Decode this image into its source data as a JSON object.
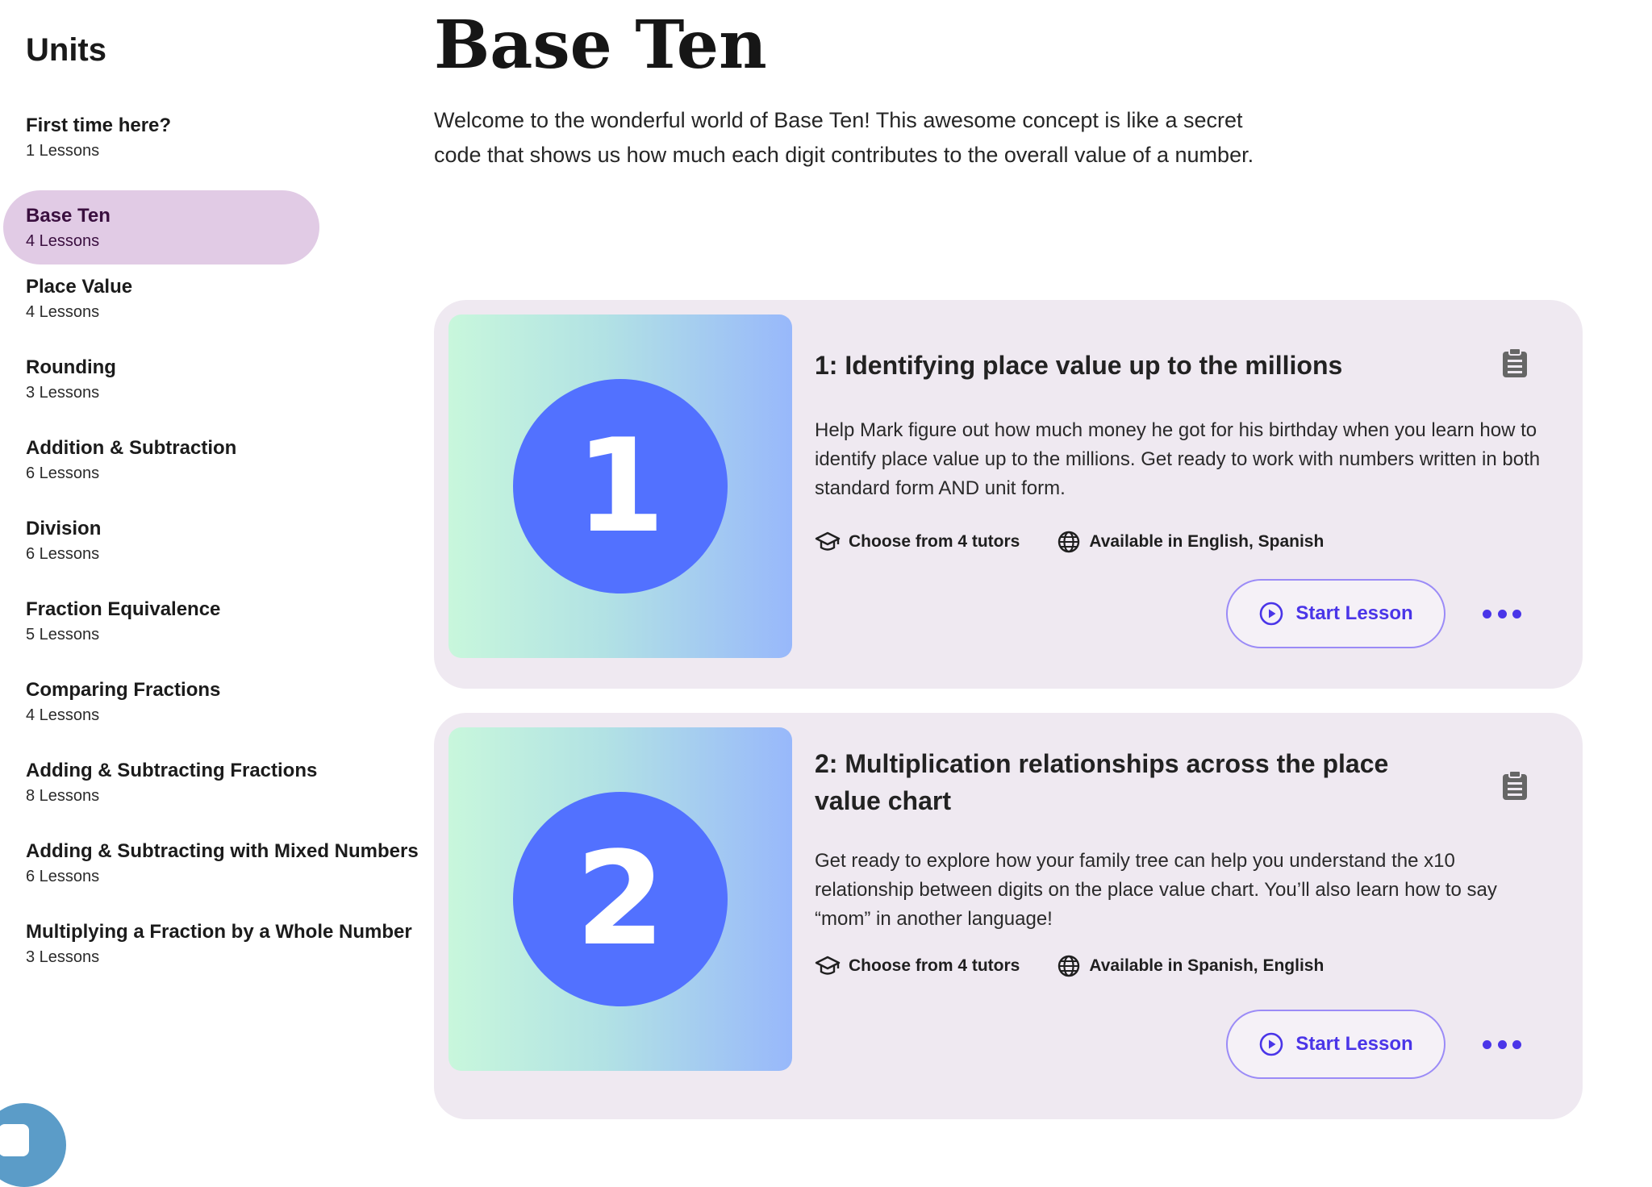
{
  "sidebar": {
    "title": "Units",
    "units": [
      {
        "name": "First time here?",
        "lessons": "1 Lessons"
      },
      {
        "name": "Base Ten",
        "lessons": "4 Lessons",
        "active": true
      },
      {
        "name": "Place Value",
        "lessons": "4 Lessons"
      },
      {
        "name": "Rounding",
        "lessons": "3 Lessons"
      },
      {
        "name": "Addition & Subtraction",
        "lessons": "6 Lessons"
      },
      {
        "name": "Division",
        "lessons": "6 Lessons"
      },
      {
        "name": "Fraction Equivalence",
        "lessons": "5 Lessons"
      },
      {
        "name": "Comparing Fractions",
        "lessons": "4 Lessons"
      },
      {
        "name": "Adding & Subtracting Fractions",
        "lessons": "8 Lessons"
      },
      {
        "name": "Adding & Subtracting with Mixed Numbers",
        "lessons": "6 Lessons"
      },
      {
        "name": "Multiplying a Fraction by a Whole Number",
        "lessons": "3 Lessons"
      }
    ]
  },
  "main": {
    "title": "Base Ten",
    "intro": "Welcome to the wonderful world of Base Ten! This awesome concept is like a secret code that shows us how much each digit contributes to the overall value of a number.",
    "lessons": [
      {
        "number": "1",
        "title": "1: Identifying place value up to the millions",
        "description": "Help Mark figure out how much money he got for his birthday when you learn how to identify place value up to the millions. Get ready to work with numbers written in both standard form AND unit form.",
        "tutors": "Choose from 4 tutors",
        "languages": "Available in English, Spanish",
        "start_label": "Start Lesson"
      },
      {
        "number": "2",
        "title": "2: Multiplication relationships across the place value chart",
        "description": "Get ready to explore how your family tree can help you understand the x10 relationship between digits on the place value chart. You’ll also learn how to say “mom” in another language!",
        "tutors": "Choose from 4 tutors",
        "languages": "Available in Spanish, English",
        "start_label": "Start Lesson"
      }
    ]
  },
  "icons": {
    "tutor": "graduation-cap-icon",
    "language": "globe-icon",
    "lesson_plan": "clipboard-icon",
    "play": "play-circle-icon",
    "more": "more-dots-icon"
  },
  "colors": {
    "accent": "#4a35e8",
    "active_unit_bg": "#e1cbe5",
    "card_bg": "#efe9f1",
    "number_circle": "#5271ff"
  }
}
